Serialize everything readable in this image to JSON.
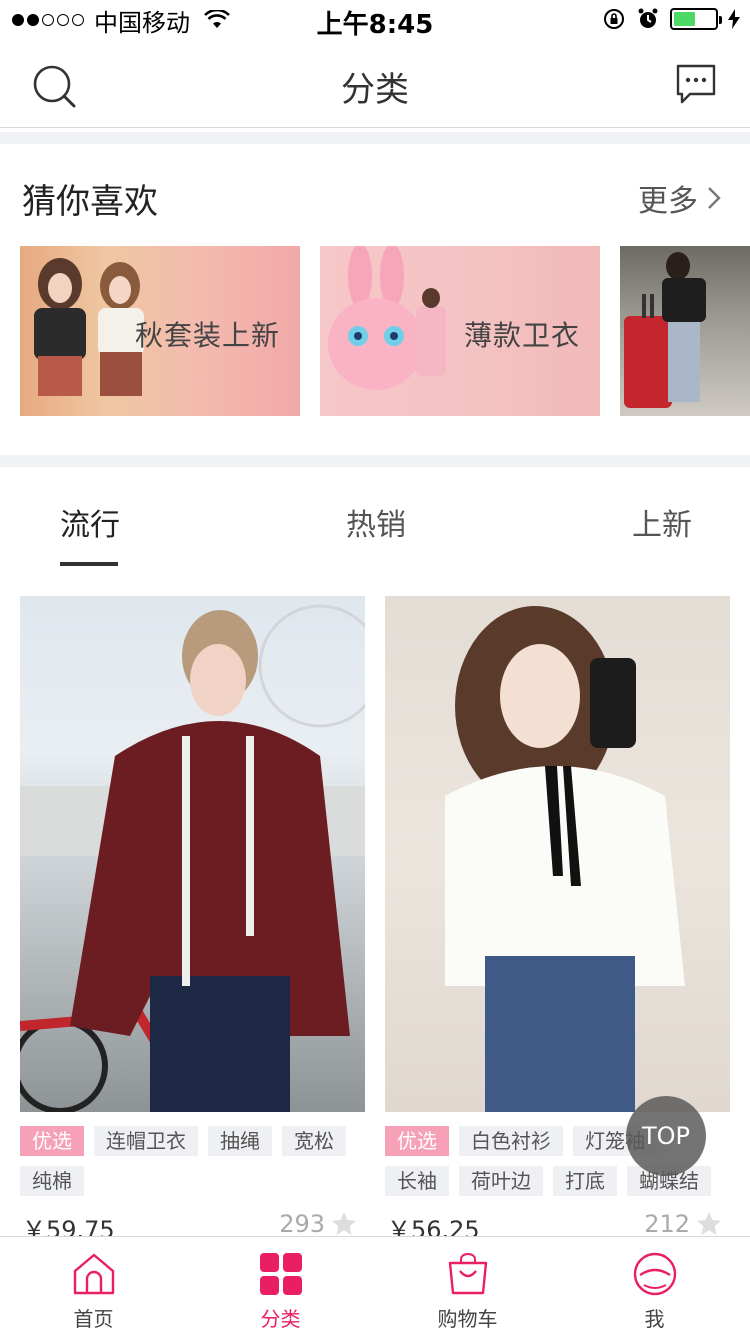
{
  "status_bar": {
    "carrier": "中国移动",
    "time": "上午8:45"
  },
  "nav": {
    "title": "分类"
  },
  "recommend": {
    "title": "猜你喜欢",
    "more": "更多",
    "banners": [
      {
        "label": "秋套装上新"
      },
      {
        "label": "薄款卫衣"
      },
      {
        "label": ""
      }
    ]
  },
  "tabs": [
    "流行",
    "热销",
    "上新"
  ],
  "products": [
    {
      "tags": [
        "优选",
        "连帽卫衣",
        "抽绳",
        "宽松",
        "纯棉"
      ],
      "price": "￥59.75",
      "likes": "293"
    },
    {
      "tags": [
        "优选",
        "白色衬衫",
        "灯笼袖",
        "长袖",
        "荷叶边",
        "打底",
        "蝴蝶结"
      ],
      "price": "￥56.25",
      "likes": "212"
    }
  ],
  "top_button": "TOP",
  "tabbar": {
    "items": [
      {
        "label": "首页",
        "icon": "home-icon"
      },
      {
        "label": "分类",
        "icon": "category-icon"
      },
      {
        "label": "购物车",
        "icon": "cart-icon"
      },
      {
        "label": "我",
        "icon": "profile-icon"
      }
    ],
    "active_color": "#e91e63"
  }
}
